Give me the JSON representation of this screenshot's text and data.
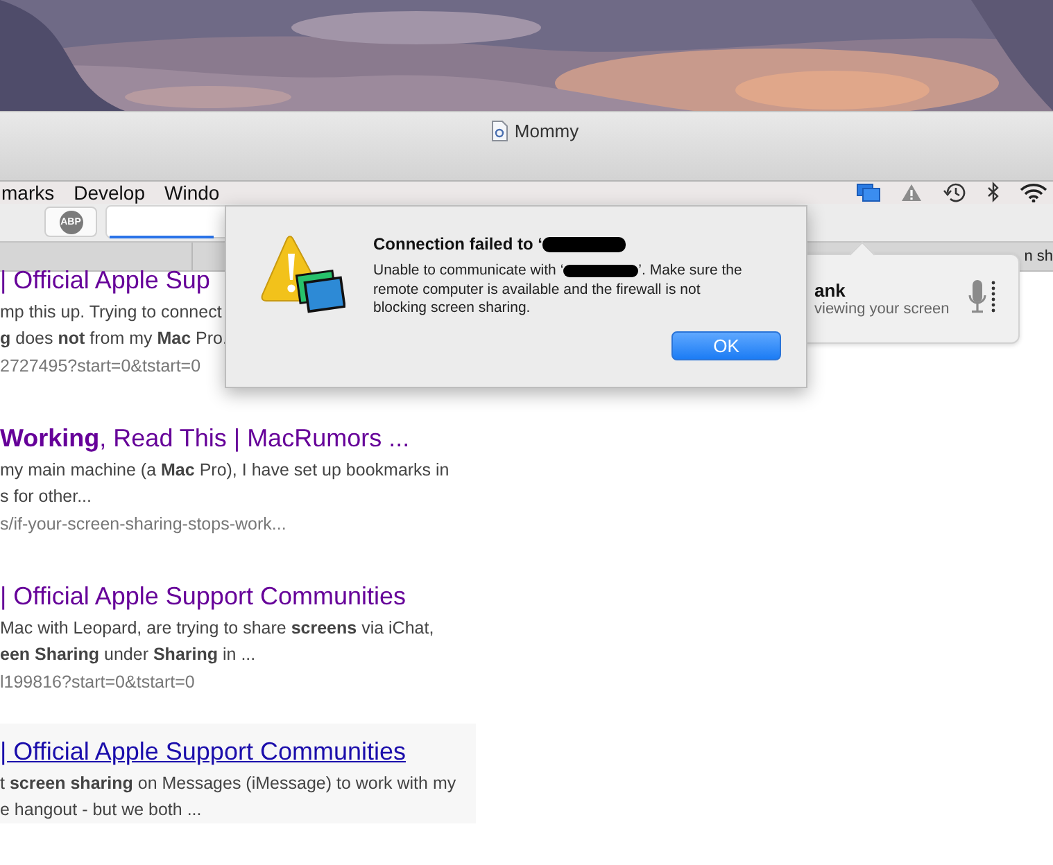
{
  "window": {
    "title": "Mommy"
  },
  "menu": [
    {
      "label": "marks"
    },
    {
      "label": "Develop"
    },
    {
      "label": "Windo"
    }
  ],
  "toolbar": {
    "adblock_label": "ABP",
    "address": {
      "level": 0.25
    }
  },
  "tab_bar": {
    "tab_label": "n sh"
  },
  "results": [
    {
      "title": "| Official Apple Sup",
      "hovered": false,
      "snippet": [
        "mp this up. Trying to connect",
        "**g** does **not** from my **Mac** Pro."
      ],
      "url": "2727495?start=0&tstart=0"
    },
    {
      "title": "**Working**, Read This | MacRumors ...",
      "hovered": false,
      "snippet": [
        "my main machine (a **Mac** Pro), I have set up bookmarks in",
        "s for other..."
      ],
      "url": "s/if-your-screen-sharing-stops-work..."
    },
    {
      "title": "| Official Apple Support Communities",
      "hovered": false,
      "snippet": [
        "Mac with Leopard, are trying to share **screens** via iChat,",
        "**een Sharing** under **Sharing** in ..."
      ],
      "url": "l199816?start=0&tstart=0"
    },
    {
      "title": "| Official Apple Support Communities",
      "hovered": true,
      "snippet": [
        "t **screen sharing** on Messages (iMessage) to work with my",
        "e hangout - but we both ..."
      ]
    }
  ],
  "notification": {
    "title": "ank",
    "body": "viewing your screen"
  },
  "dialog": {
    "title": "Connection failed to ‘",
    "message_start": "Unable to communicate with ‘",
    "message_end": "’.  Make sure the remote computer is available and the firewall is not blocking screen sharing.",
    "button": "OK"
  }
}
